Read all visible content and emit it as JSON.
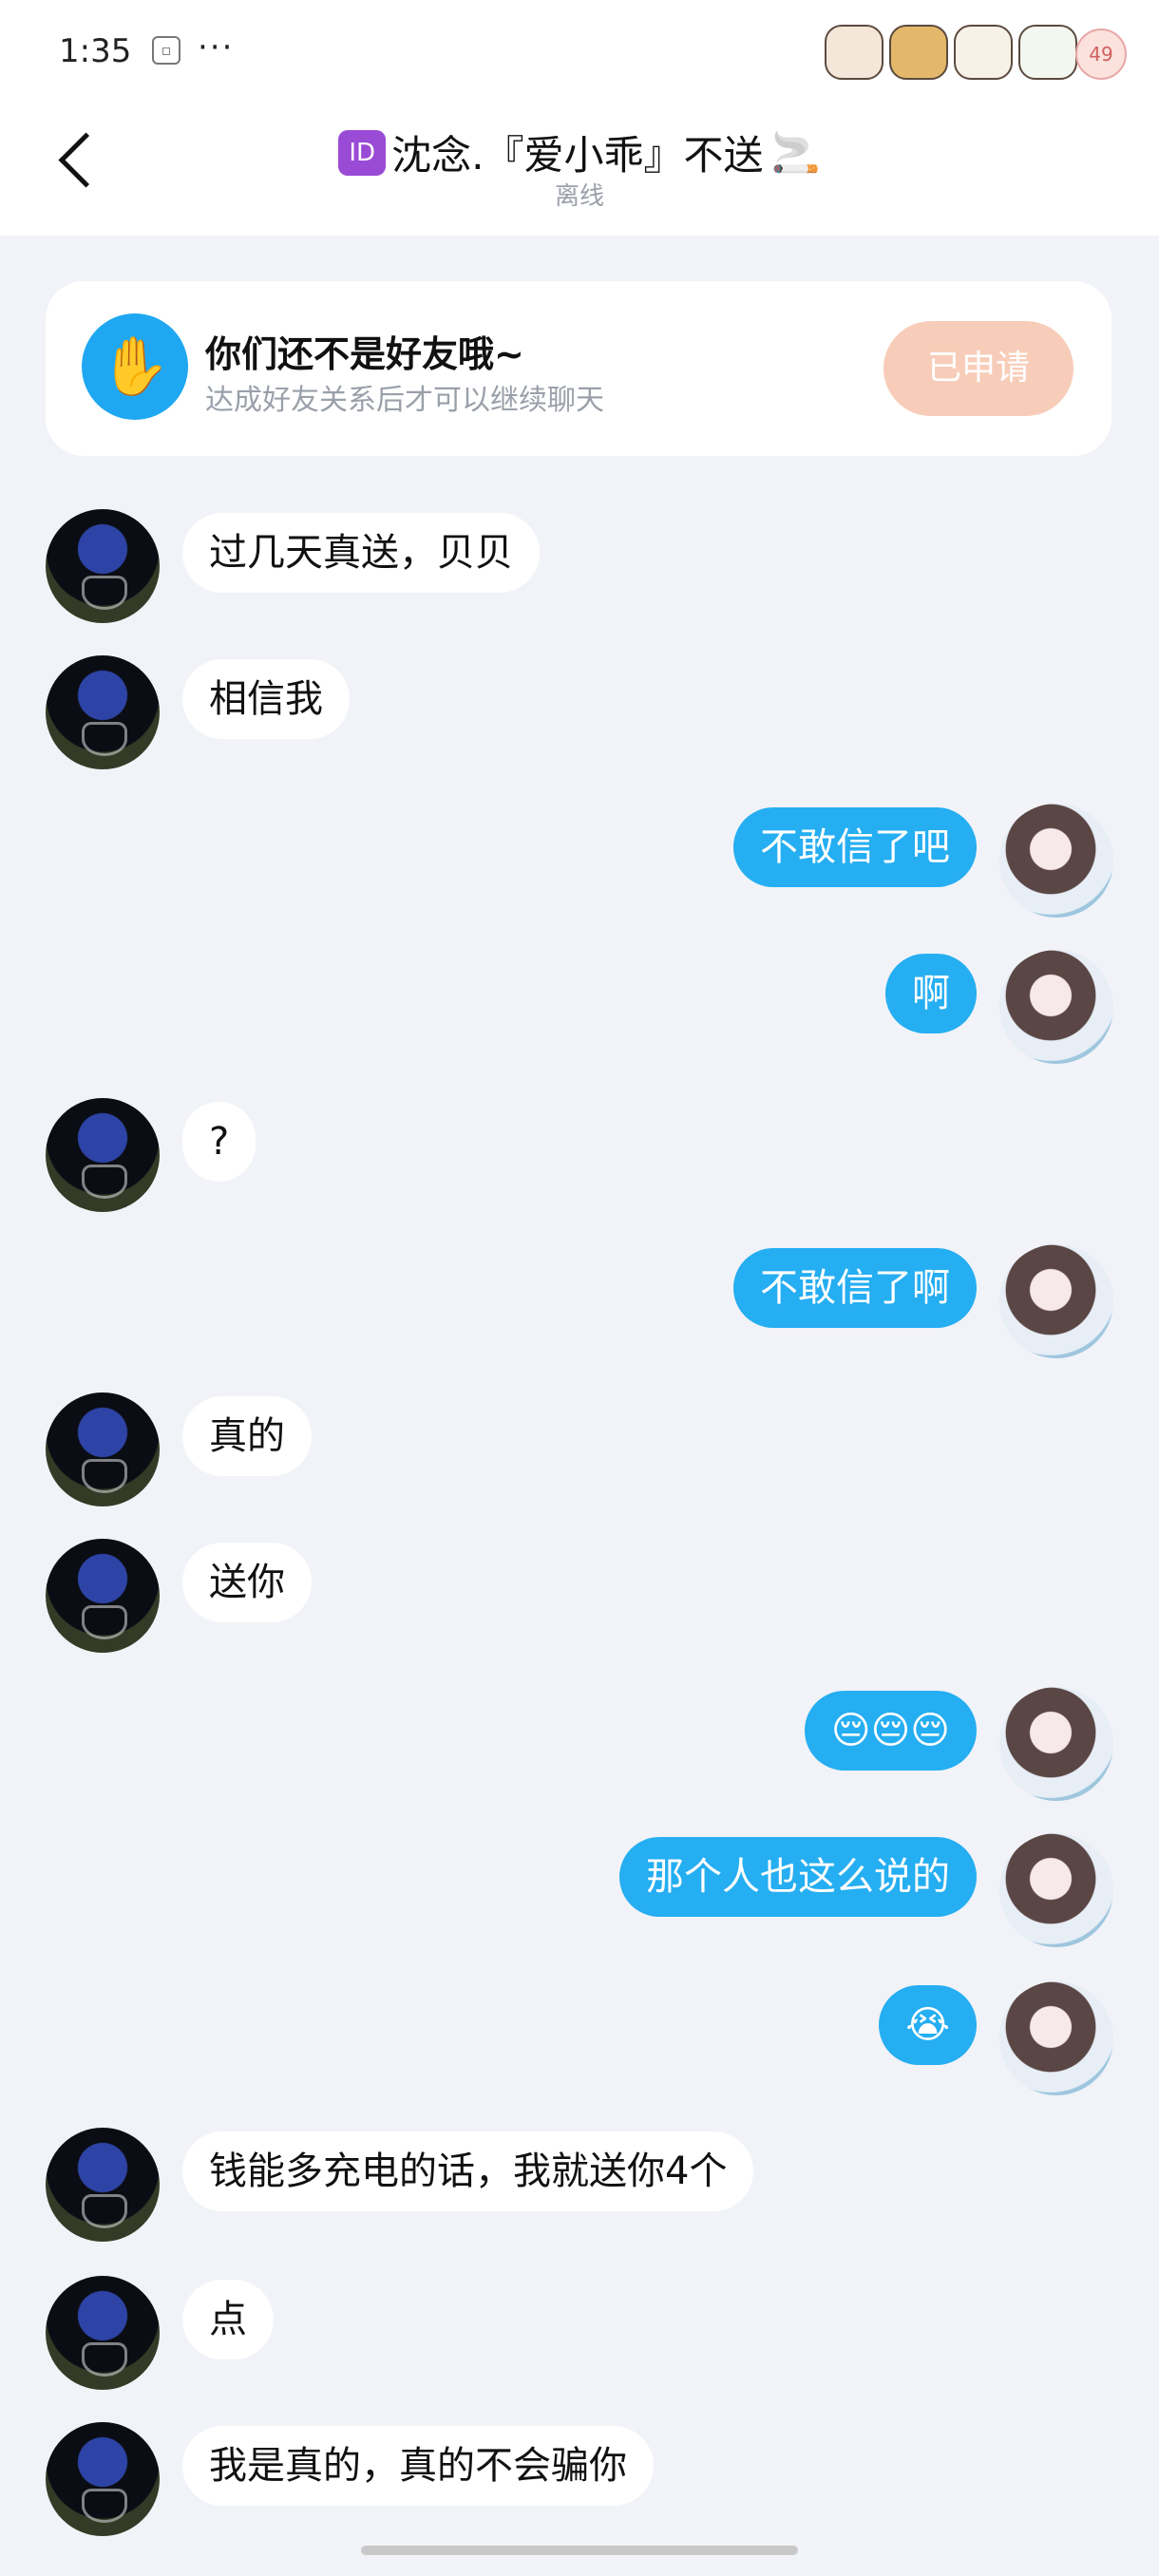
{
  "status_bar": {
    "time": "1:35",
    "dots": "···",
    "battery": "49"
  },
  "header": {
    "id_badge": "ID",
    "title": "沈念.『爱小乖』不送",
    "title_emoji": "🚬",
    "subtitle": "离线"
  },
  "friend_card": {
    "title": "你们还不是好友哦~",
    "description": "达成好友关系后才可以继续聊天",
    "button_label": "已申请"
  },
  "messages": [
    {
      "side": "left",
      "text": "过几天真送，贝贝"
    },
    {
      "side": "left",
      "text": "相信我"
    },
    {
      "side": "right",
      "text": "不敢信了吧"
    },
    {
      "side": "right",
      "text": "啊"
    },
    {
      "side": "left",
      "text": "?"
    },
    {
      "side": "right",
      "text": "不敢信了啊"
    },
    {
      "side": "left",
      "text": "真的"
    },
    {
      "side": "left",
      "text": "送你"
    },
    {
      "side": "right",
      "text": "😔😔😔"
    },
    {
      "side": "right",
      "text": "那个人也这么说的"
    },
    {
      "side": "right",
      "text": "😭"
    },
    {
      "side": "left",
      "text": "钱能多充电的话，我就送你4个"
    },
    {
      "side": "left",
      "text": "点"
    },
    {
      "side": "left",
      "text": "我是真的，真的不会骗你"
    }
  ],
  "colors": {
    "accent_blue": "#25aef1",
    "background": "#f1f3f8",
    "applied_button": "#f7cdb9"
  }
}
